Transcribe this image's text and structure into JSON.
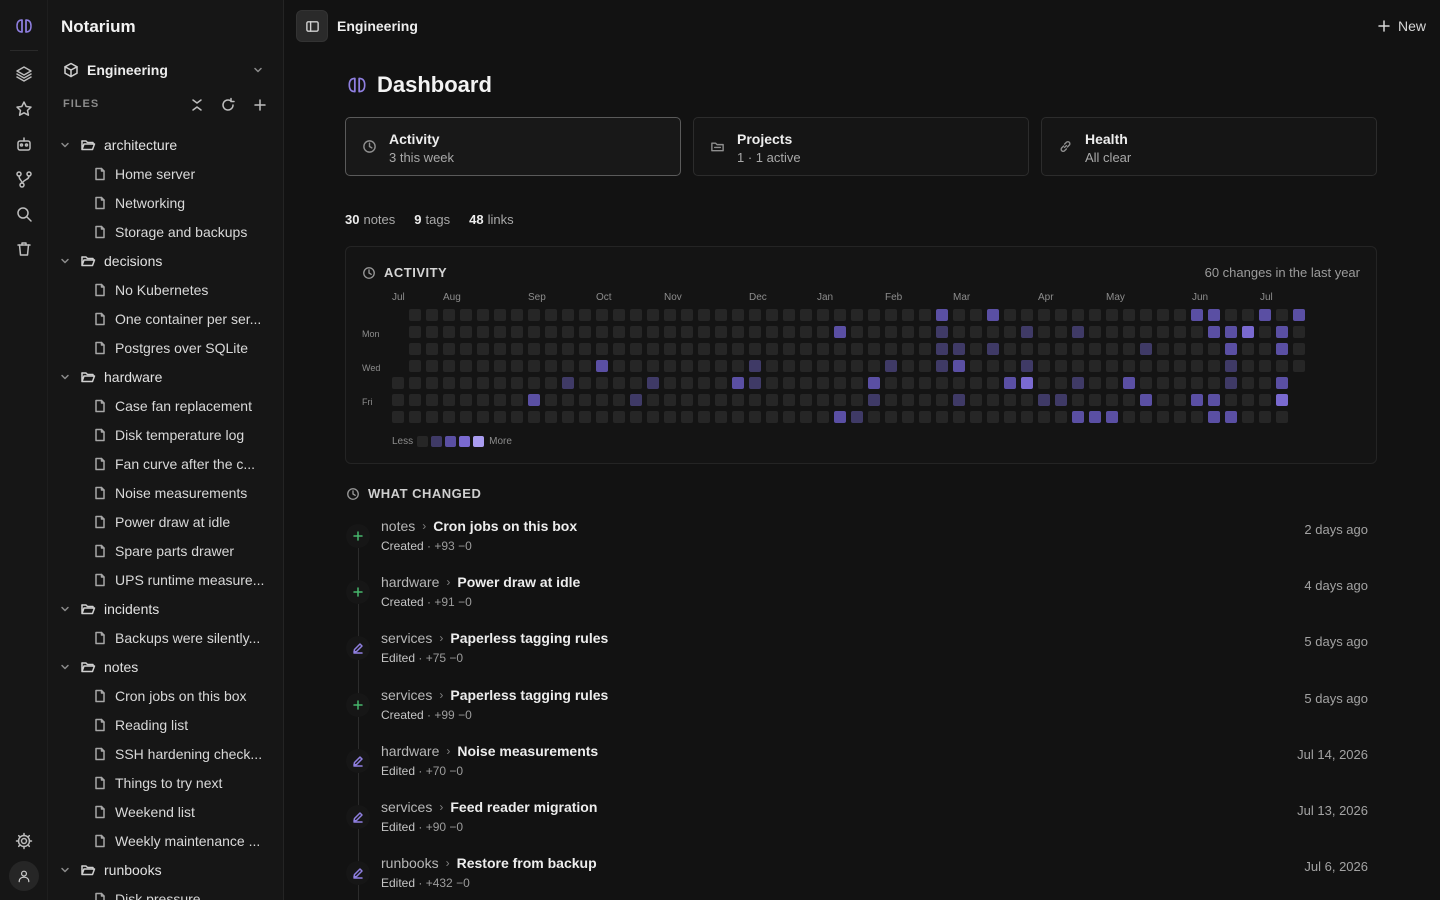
{
  "app": {
    "name": "Notarium"
  },
  "rail": {
    "icons": [
      "layers-icon",
      "star-icon",
      "robot-icon",
      "git-branch-icon",
      "search-icon",
      "trash-icon"
    ],
    "bottom": [
      "settings-icon",
      "user-icon"
    ]
  },
  "sidebar": {
    "workspace": "Engineering",
    "files_header": "FILES",
    "tree": [
      {
        "type": "folder",
        "label": "architecture"
      },
      {
        "type": "file",
        "label": "Home server"
      },
      {
        "type": "file",
        "label": "Networking"
      },
      {
        "type": "file",
        "label": "Storage and backups"
      },
      {
        "type": "folder",
        "label": "decisions"
      },
      {
        "type": "file",
        "label": "No Kubernetes"
      },
      {
        "type": "file",
        "label": "One container per ser..."
      },
      {
        "type": "file",
        "label": "Postgres over SQLite"
      },
      {
        "type": "folder",
        "label": "hardware"
      },
      {
        "type": "file",
        "label": "Case fan replacement"
      },
      {
        "type": "file",
        "label": "Disk temperature log"
      },
      {
        "type": "file",
        "label": "Fan curve after the c..."
      },
      {
        "type": "file",
        "label": "Noise measurements"
      },
      {
        "type": "file",
        "label": "Power draw at idle"
      },
      {
        "type": "file",
        "label": "Spare parts drawer"
      },
      {
        "type": "file",
        "label": "UPS runtime measure..."
      },
      {
        "type": "folder",
        "label": "incidents"
      },
      {
        "type": "file",
        "label": "Backups were silently..."
      },
      {
        "type": "folder",
        "label": "notes"
      },
      {
        "type": "file",
        "label": "Cron jobs on this box"
      },
      {
        "type": "file",
        "label": "Reading list"
      },
      {
        "type": "file",
        "label": "SSH hardening check..."
      },
      {
        "type": "file",
        "label": "Things to try next"
      },
      {
        "type": "file",
        "label": "Weekend list"
      },
      {
        "type": "file",
        "label": "Weekly maintenance ..."
      },
      {
        "type": "folder",
        "label": "runbooks"
      },
      {
        "type": "file",
        "label": "Disk pressure"
      }
    ]
  },
  "topbar": {
    "breadcrumb": "Engineering",
    "new_label": "New"
  },
  "main": {
    "title": "Dashboard",
    "cards": [
      {
        "title": "Activity",
        "subtitle": "3 this week",
        "icon": "clock-icon",
        "active": true
      },
      {
        "title": "Projects",
        "subtitle": "1 · 1 active",
        "icon": "folder-icon",
        "active": false
      },
      {
        "title": "Health",
        "subtitle": "All clear",
        "icon": "link-icon",
        "active": false
      }
    ],
    "stats": {
      "notes_count": "30",
      "notes_label": "notes",
      "tags_count": "9",
      "tags_label": "tags",
      "links_count": "48",
      "links_label": "links"
    },
    "activity": {
      "title": "ACTIVITY",
      "summary": "60 changes in the last year",
      "months": [
        "Jul",
        "Aug",
        "Sep",
        "Oct",
        "Nov",
        "Dec",
        "Jan",
        "Feb",
        "Mar",
        "Apr",
        "May",
        "Jun",
        "Jul"
      ],
      "days": [
        "Mon",
        "Wed",
        "Fri"
      ],
      "legend_less": "Less",
      "legend_more": "More",
      "colors": {
        "empty": "#262626",
        "l1": "#3f3a66",
        "l2": "#5a4fa3",
        "l3": "#7a6ad0",
        "l4": "#a99cf0"
      }
    },
    "changes_title": "WHAT CHANGED",
    "changes": [
      {
        "kind": "add",
        "folder": "notes",
        "title": "Cron jobs on this box",
        "action": "Created",
        "diff": "· +93 −0",
        "time": "2 days ago"
      },
      {
        "kind": "add",
        "folder": "hardware",
        "title": "Power draw at idle",
        "action": "Created",
        "diff": "· +91 −0",
        "time": "4 days ago"
      },
      {
        "kind": "edit",
        "folder": "services",
        "title": "Paperless tagging rules",
        "action": "Edited",
        "diff": "· +75 −0",
        "time": "5 days ago"
      },
      {
        "kind": "add",
        "folder": "services",
        "title": "Paperless tagging rules",
        "action": "Created",
        "diff": "· +99 −0",
        "time": "5 days ago"
      },
      {
        "kind": "edit",
        "folder": "hardware",
        "title": "Noise measurements",
        "action": "Edited",
        "diff": "· +70 −0",
        "time": "Jul 14, 2026"
      },
      {
        "kind": "edit",
        "folder": "services",
        "title": "Feed reader migration",
        "action": "Edited",
        "diff": "· +90 −0",
        "time": "Jul 13, 2026"
      },
      {
        "kind": "edit",
        "folder": "runbooks",
        "title": "Restore from backup",
        "action": "Edited",
        "diff": "· +432 −0",
        "time": "Jul 6, 2026"
      }
    ]
  }
}
